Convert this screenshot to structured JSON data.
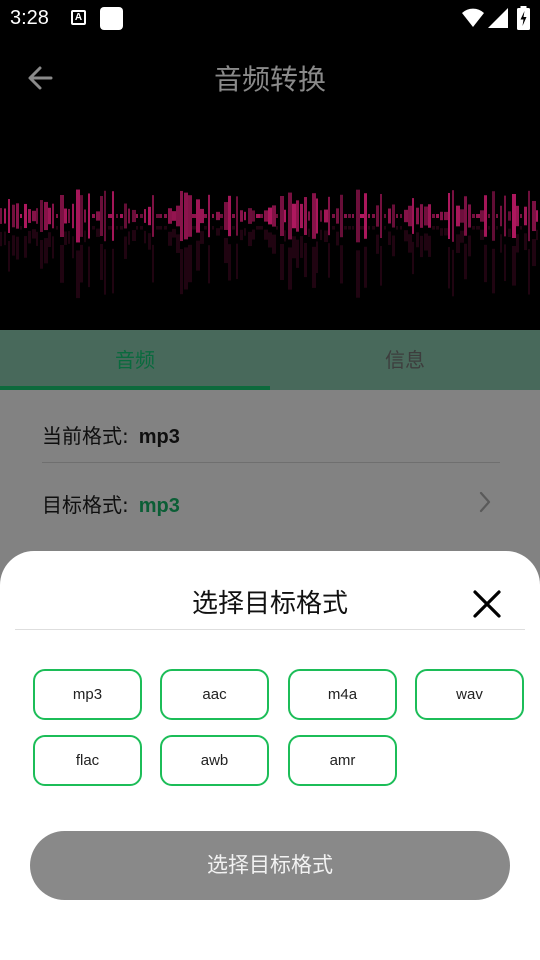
{
  "status_bar": {
    "time": "3:28",
    "notification_letter": "A",
    "icons": [
      "a-notification-icon",
      "square-notification-icon",
      "wifi-icon",
      "signal-icon",
      "battery-charging-icon"
    ]
  },
  "app_bar": {
    "title": "音频转换",
    "back_icon": "arrow-left-icon"
  },
  "tabs": [
    {
      "label": "音频",
      "selected": true
    },
    {
      "label": "信息",
      "selected": false
    }
  ],
  "info": {
    "current_format_label": "当前格式:",
    "current_format_value": "mp3",
    "target_format_label": "目标格式:",
    "target_format_value": "mp3"
  },
  "sheet": {
    "title": "选择目标格式",
    "close_icon": "close-icon",
    "formats": [
      "mp3",
      "aac",
      "m4a",
      "wav",
      "flac",
      "awb",
      "amr"
    ],
    "confirm_label": "选择目标格式"
  },
  "colors": {
    "accent_green": "#1cbd58",
    "tab_selected": "#0a6a3e",
    "waveform": "#b0185f"
  }
}
